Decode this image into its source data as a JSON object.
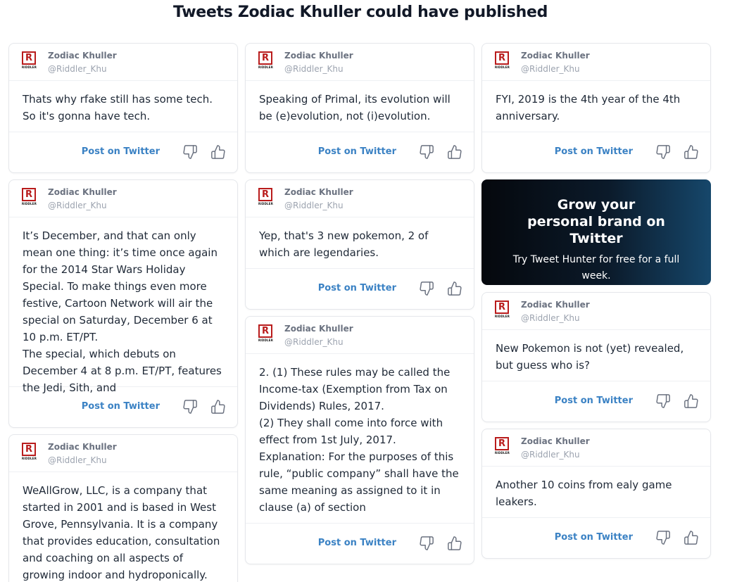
{
  "page": {
    "title": "Tweets Zodiac Khuller could have published"
  },
  "profile": {
    "name": "Zodiac Khuller",
    "handle": "@Riddler_Khu",
    "logo_letter": "R",
    "logo_text": "RIDDLER"
  },
  "actions": {
    "post_label": "Post on Twitter"
  },
  "promo": {
    "title": "Grow your personal brand on Twitter",
    "subtitle": "Try Tweet Hunter for free for a full week."
  },
  "tweets": [
    {
      "text": "Thats why rfake still has some tech. So it's gonna have tech."
    },
    {
      "text": "It’s December, and that can only mean one thing: it’s time once again for the 2014 Star Wars Holiday Special. To make things even more festive, Cartoon Network will air the special on Saturday, December 6 at 10 p.m. ET/PT.\nThe special, which debuts on December 4 at 8 p.m. ET/PT, features the Jedi, Sith, and"
    },
    {
      "text": "WeAllGrow, LLC, is a company that started in 2001 and is based in West Grove, Pennsylvania. It is a company that provides education, consultation and coaching on all aspects of growing indoor and hydroponically. The"
    },
    {
      "text": "Speaking of Primal, its evolution will be (e)evolution, not (i)evolution."
    },
    {
      "text": "Yep, that's 3 new pokemon, 2 of which are legendaries."
    },
    {
      "text": "2. (1) These rules may be called the Income-tax (Exemption from Tax on Dividends) Rules, 2017.\n(2) They shall come into force with effect from 1st July, 2017.\nExplanation: For the purposes of this rule, “public company” shall have the same meaning as assigned to it in clause (a) of section"
    },
    {
      "text": "FYI, 2019 is the 4th year of the 4th anniversary."
    },
    {
      "text": "New Pokemon is not (yet) revealed, but guess who is?"
    },
    {
      "text": "Another 10 coins from ealy game leakers."
    }
  ]
}
